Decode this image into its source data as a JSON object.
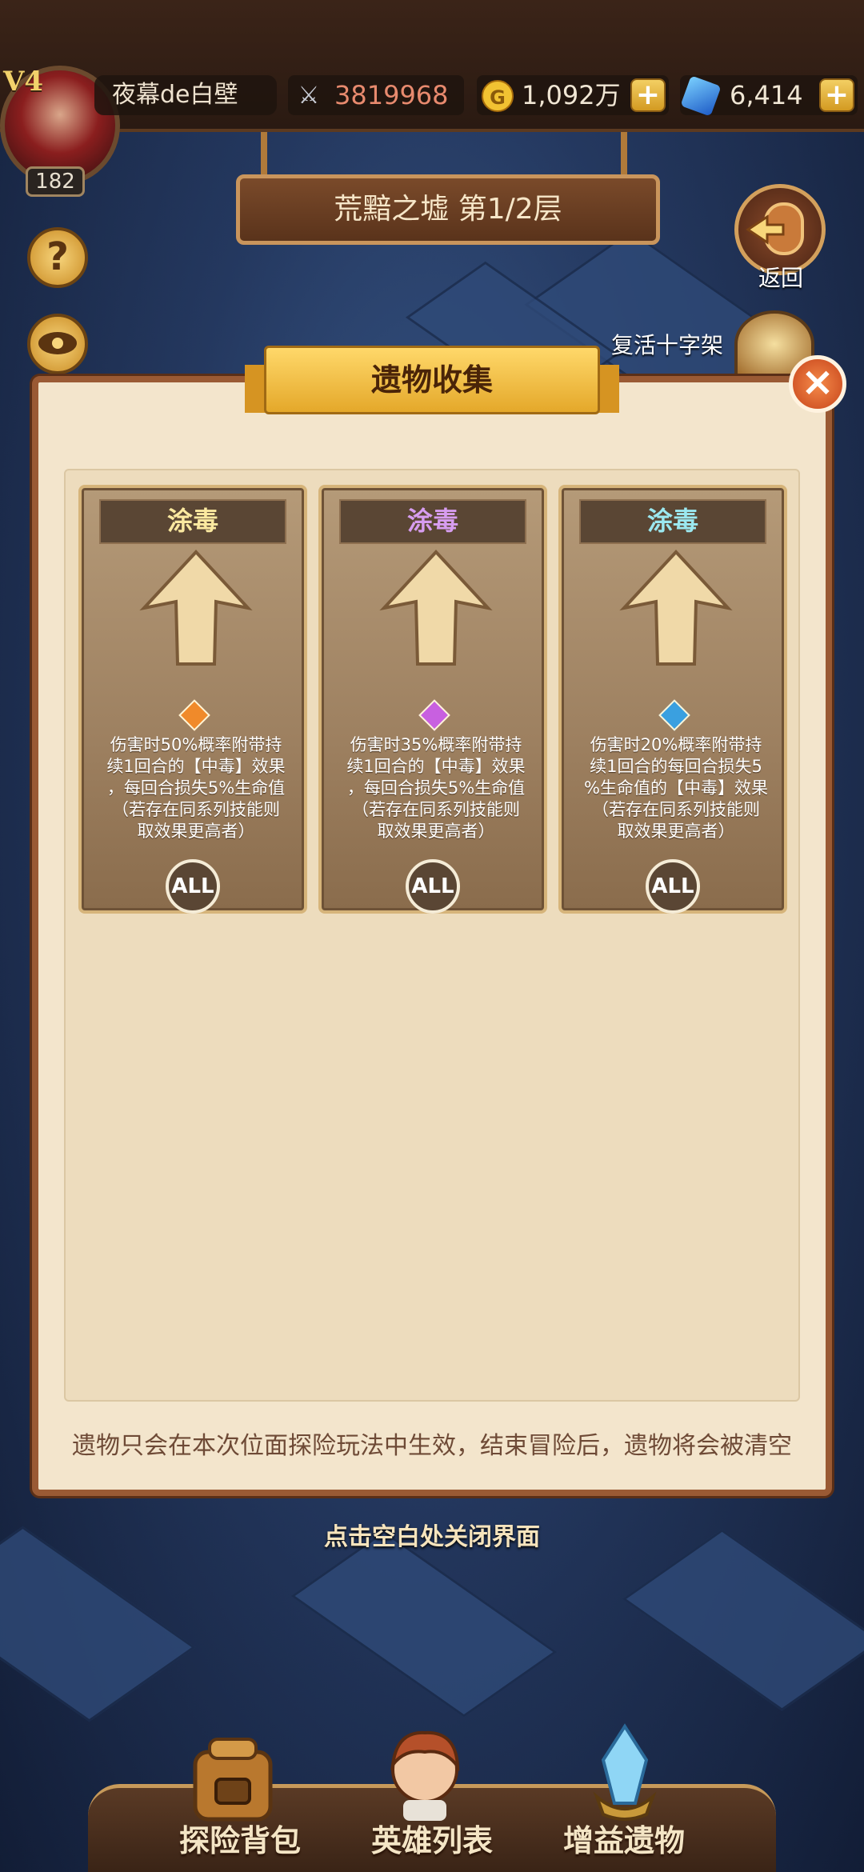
{
  "header": {
    "vip": "V4",
    "level": "182",
    "player_name": "夜幕de白壁",
    "power": "3819968",
    "gold": "1,092万",
    "gems": "6,414",
    "gold_icon_glyph": "G",
    "plus_glyph": "+"
  },
  "floor_title": "荒黯之墟 第1/2层",
  "side": {
    "help_glyph": "?",
    "back_label": "返回",
    "cross_label": "复活十字架"
  },
  "modal": {
    "title": "遗物收集",
    "close_glyph": "×",
    "cards": [
      {
        "name": "涂毒",
        "desc_lines": [
          "伤害时50%概率附带持",
          "续1回合的【中毒】效果",
          "，每回合损失5%生命值",
          "（若存在同系列技能则",
          "取效果更高者）"
        ],
        "badge": "ALL",
        "gem_color": "#f08a2a"
      },
      {
        "name": "涂毒",
        "desc_lines": [
          "伤害时35%概率附带持",
          "续1回合的【中毒】效果",
          "，每回合损失5%生命值",
          "（若存在同系列技能则",
          "取效果更高者）"
        ],
        "badge": "ALL",
        "gem_color": "#c860e0"
      },
      {
        "name": "涂毒",
        "desc_lines": [
          "伤害时20%概率附带持",
          "续1回合的每回合损失5",
          "%生命值的【中毒】效果",
          "（若存在同系列技能则",
          "取效果更高者）"
        ],
        "badge": "ALL",
        "gem_color": "#3aa0e0"
      }
    ],
    "footnote": "遗物只会在本次位面探险玩法中生效，结束冒险后，遗物将会被清空"
  },
  "close_hint": "点击空白处关闭界面",
  "bottom_nav": [
    {
      "label": "探险背包",
      "icon": "backpack-icon"
    },
    {
      "label": "英雄列表",
      "icon": "hero-icon"
    },
    {
      "label": "增益遗物",
      "icon": "crystal-relic-icon"
    }
  ],
  "colors": {
    "modal_bg": "#f3e5cc",
    "modal_border": "#9a5a34",
    "ribbon": "#e4a82a",
    "card": "#9d8060"
  }
}
